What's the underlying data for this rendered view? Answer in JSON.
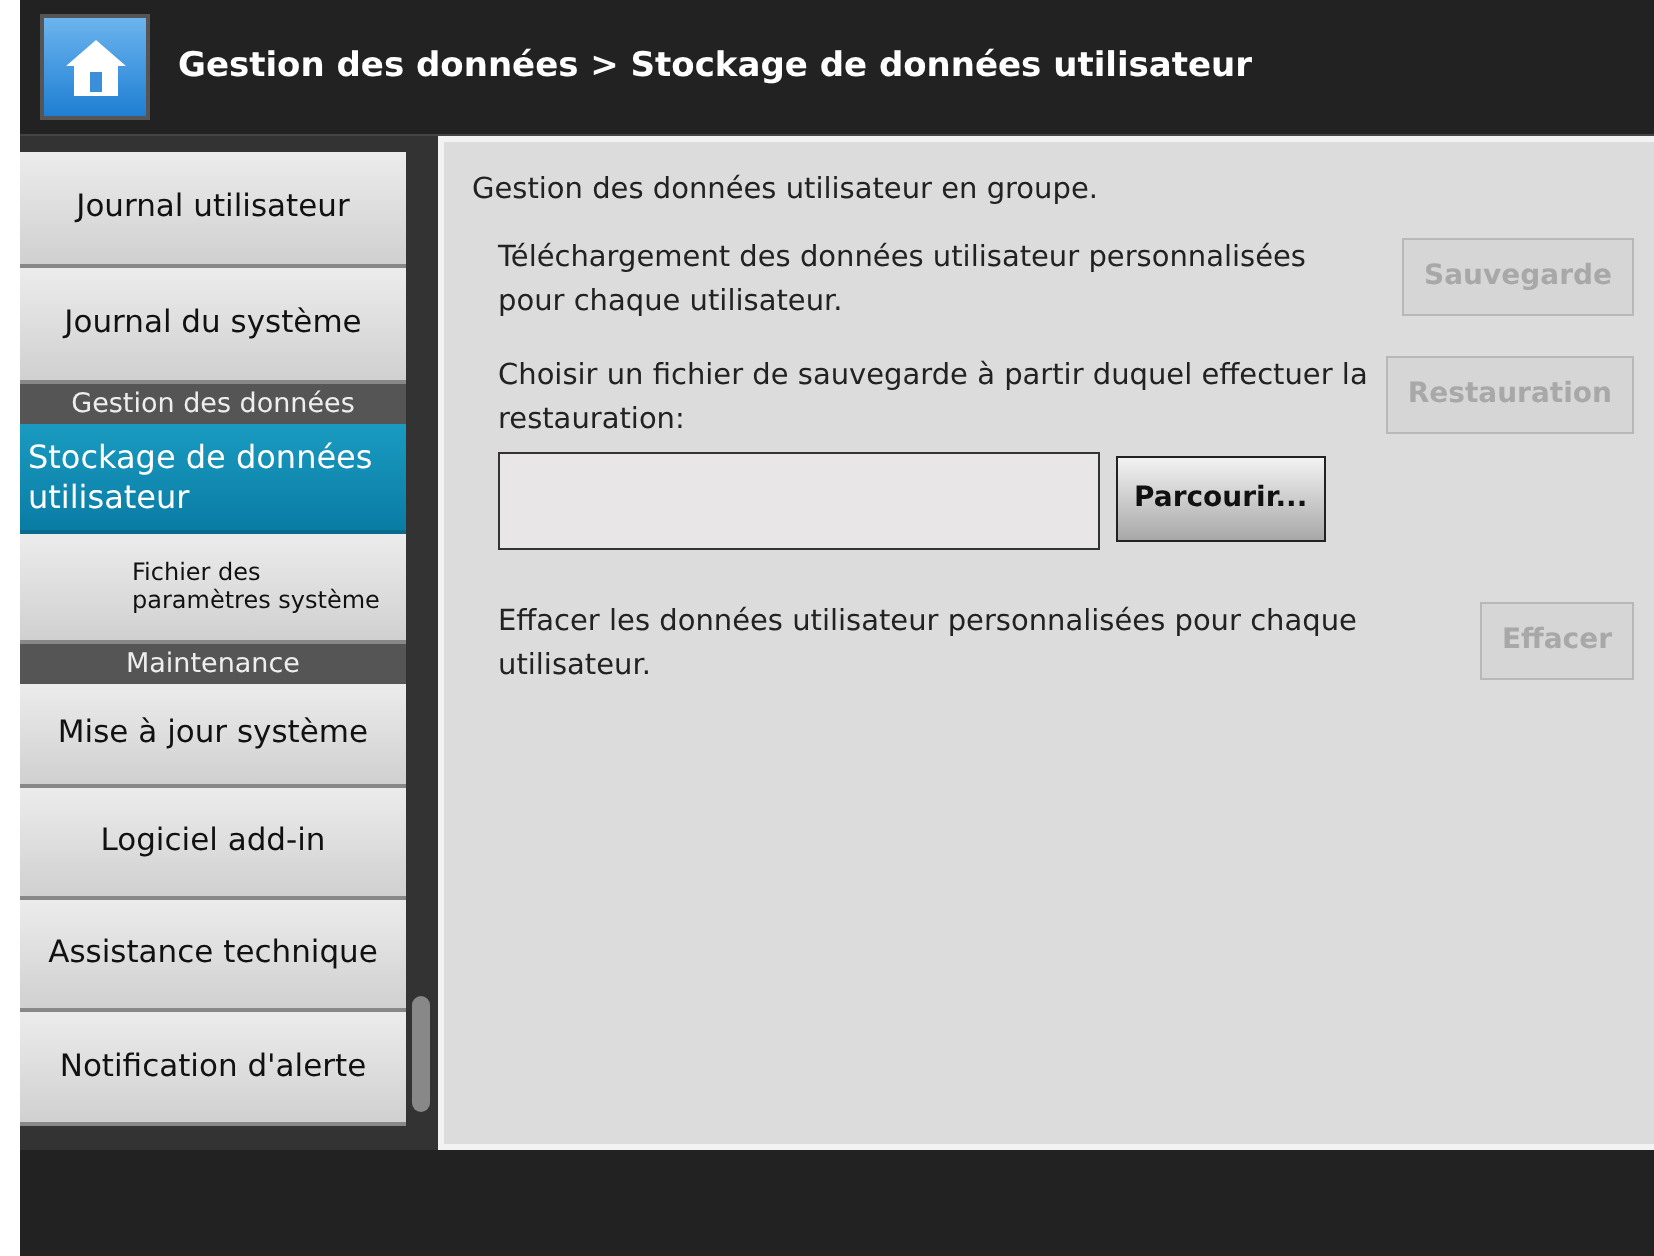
{
  "header": {
    "title": "Gestion des données > Stockage de données utilisateur"
  },
  "sidebar": {
    "items": [
      {
        "kind": "item",
        "label": "Journal utilisateur",
        "selected": false
      },
      {
        "kind": "item",
        "label": "Journal du système",
        "selected": false
      },
      {
        "kind": "category",
        "label": "Gestion des données"
      },
      {
        "kind": "item",
        "label": "Stockage de données utilisateur",
        "selected": true
      },
      {
        "kind": "subitem",
        "label": "Fichier des paramètres système",
        "selected": false
      },
      {
        "kind": "category",
        "label": "Maintenance"
      },
      {
        "kind": "item",
        "label": "Mise à jour système",
        "selected": false
      },
      {
        "kind": "item",
        "label": "Logiciel add-in",
        "selected": false
      },
      {
        "kind": "item",
        "label": "Assistance technique",
        "selected": false
      },
      {
        "kind": "item",
        "label": "Notification d'alerte",
        "selected": false
      }
    ]
  },
  "content": {
    "intro": "Gestion des données utilisateur en groupe.",
    "sections": [
      {
        "text": "Téléchargement des données utilisateur personnalisées pour chaque utilisateur.",
        "button": {
          "label": "Sauvegarde",
          "disabled": true
        }
      },
      {
        "text": "Choisir un fichier de sauvegarde à partir duquel effectuer la restauration:",
        "button": {
          "label": "Restauration",
          "disabled": true
        },
        "file": {
          "browse": {
            "label": "Parcourir...",
            "disabled": false
          }
        }
      },
      {
        "text": "Effacer les données utilisateur personnalisées pour chaque utilisateur.",
        "button": {
          "label": "Effacer",
          "disabled": true
        }
      }
    ]
  }
}
